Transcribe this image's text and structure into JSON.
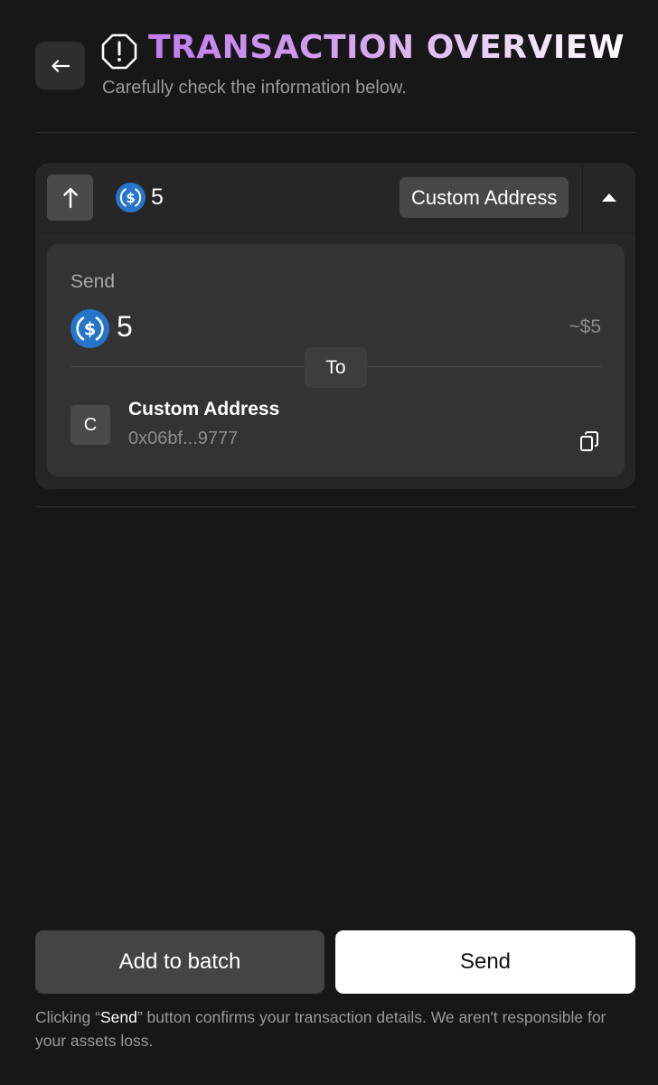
{
  "header": {
    "title": "TRANSACTION OVERVIEW",
    "subtitle": "Carefully check the information below."
  },
  "card": {
    "header_amount": "5",
    "destination_badge": "Custom Address",
    "send_label": "Send",
    "amount": "5",
    "usd_value": "~$5",
    "to_label": "To",
    "recipient": {
      "avatar_letter": "C",
      "name": "Custom Address",
      "address": "0x06bf...9777"
    }
  },
  "footer": {
    "add_to_batch_label": "Add to batch",
    "send_label": "Send",
    "disclaimer_prefix": "Clicking “",
    "disclaimer_highlight": "Send",
    "disclaimer_suffix": "” button confirms your transaction details. We aren't responsible for your assets loss."
  },
  "icons": {
    "back": "arrow-left-icon",
    "warning": "warning-octagon-icon",
    "direction": "arrow-up-icon",
    "token": "usdc-icon",
    "collapse": "caret-up-icon",
    "copy": "copy-icon"
  },
  "colors": {
    "background": "#171717",
    "card": "#262626",
    "inner_card": "#333333",
    "title_gradient_start": "#c07cf0",
    "token_blue": "#2775ca",
    "send_button": "#ffffff",
    "batch_button": "#444444"
  }
}
